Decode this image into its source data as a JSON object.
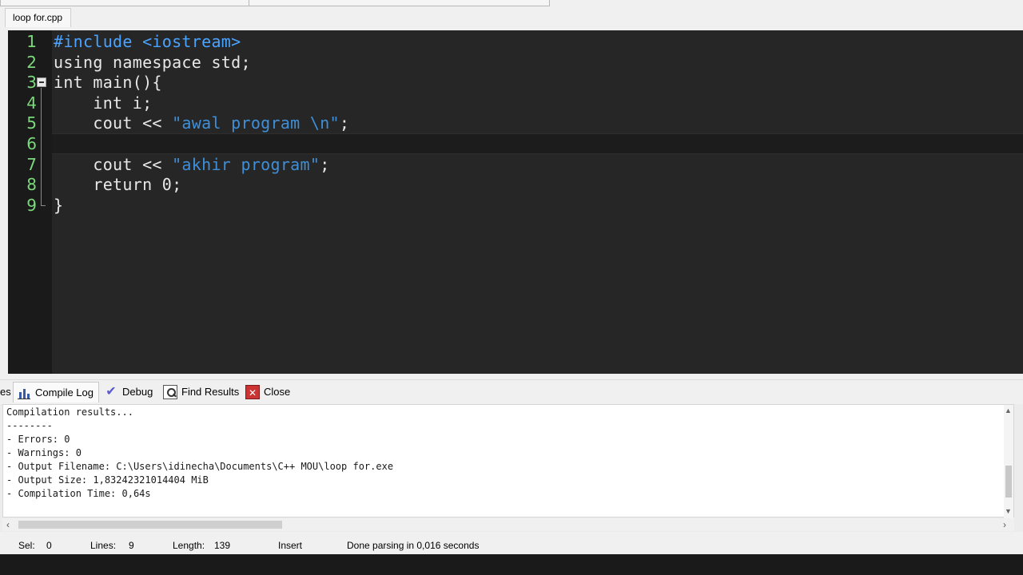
{
  "window": {
    "file_tab": "loop for.cpp"
  },
  "editor": {
    "lines": [
      {
        "n": "1",
        "parts": [
          {
            "t": "#include <iostream>",
            "c": "kw-inc"
          }
        ]
      },
      {
        "n": "2",
        "parts": [
          {
            "t": "using namespace std;",
            "c": "plain"
          }
        ]
      },
      {
        "n": "3",
        "parts": [
          {
            "t": "int main(){",
            "c": "plain"
          }
        ]
      },
      {
        "n": "4",
        "parts": [
          {
            "t": "    int i;",
            "c": "plain"
          }
        ]
      },
      {
        "n": "5",
        "parts": [
          {
            "t": "    cout << ",
            "c": "plain"
          },
          {
            "t": "\"awal program \\n\"",
            "c": "str"
          },
          {
            "t": ";",
            "c": "plain"
          }
        ]
      },
      {
        "n": "6",
        "parts": [
          {
            "t": "",
            "c": "plain"
          }
        ]
      },
      {
        "n": "7",
        "parts": [
          {
            "t": "    cout << ",
            "c": "plain"
          },
          {
            "t": "\"akhir program\"",
            "c": "str"
          },
          {
            "t": ";",
            "c": "plain"
          }
        ]
      },
      {
        "n": "8",
        "parts": [
          {
            "t": "    return 0;",
            "c": "plain"
          }
        ]
      },
      {
        "n": "9",
        "parts": [
          {
            "t": "}",
            "c": "plain"
          }
        ]
      }
    ],
    "current_line": 6
  },
  "panel": {
    "cut_tab": "es",
    "tabs": [
      {
        "label": "Compile Log",
        "icon": "chart-icon",
        "active": true
      },
      {
        "label": "Debug",
        "icon": "check-icon",
        "active": false
      },
      {
        "label": "Find Results",
        "icon": "find-icon",
        "active": false
      },
      {
        "label": "Close",
        "icon": "close-icon",
        "active": false
      }
    ]
  },
  "log": {
    "lines": [
      "Compilation results...",
      "--------",
      "- Errors: 0",
      "- Warnings: 0",
      "- Output Filename: C:\\Users\\idinecha\\Documents\\C++ MOU\\loop for.exe",
      "- Output Size: 1,83242321014404 MiB",
      "- Compilation Time: 0,64s"
    ]
  },
  "status": {
    "sel_label": "Sel:",
    "sel_value": "0",
    "lines_label": "Lines:",
    "lines_value": "9",
    "length_label": "Length:",
    "length_value": "139",
    "mode": "Insert",
    "message": "Done parsing in 0,016 seconds"
  }
}
